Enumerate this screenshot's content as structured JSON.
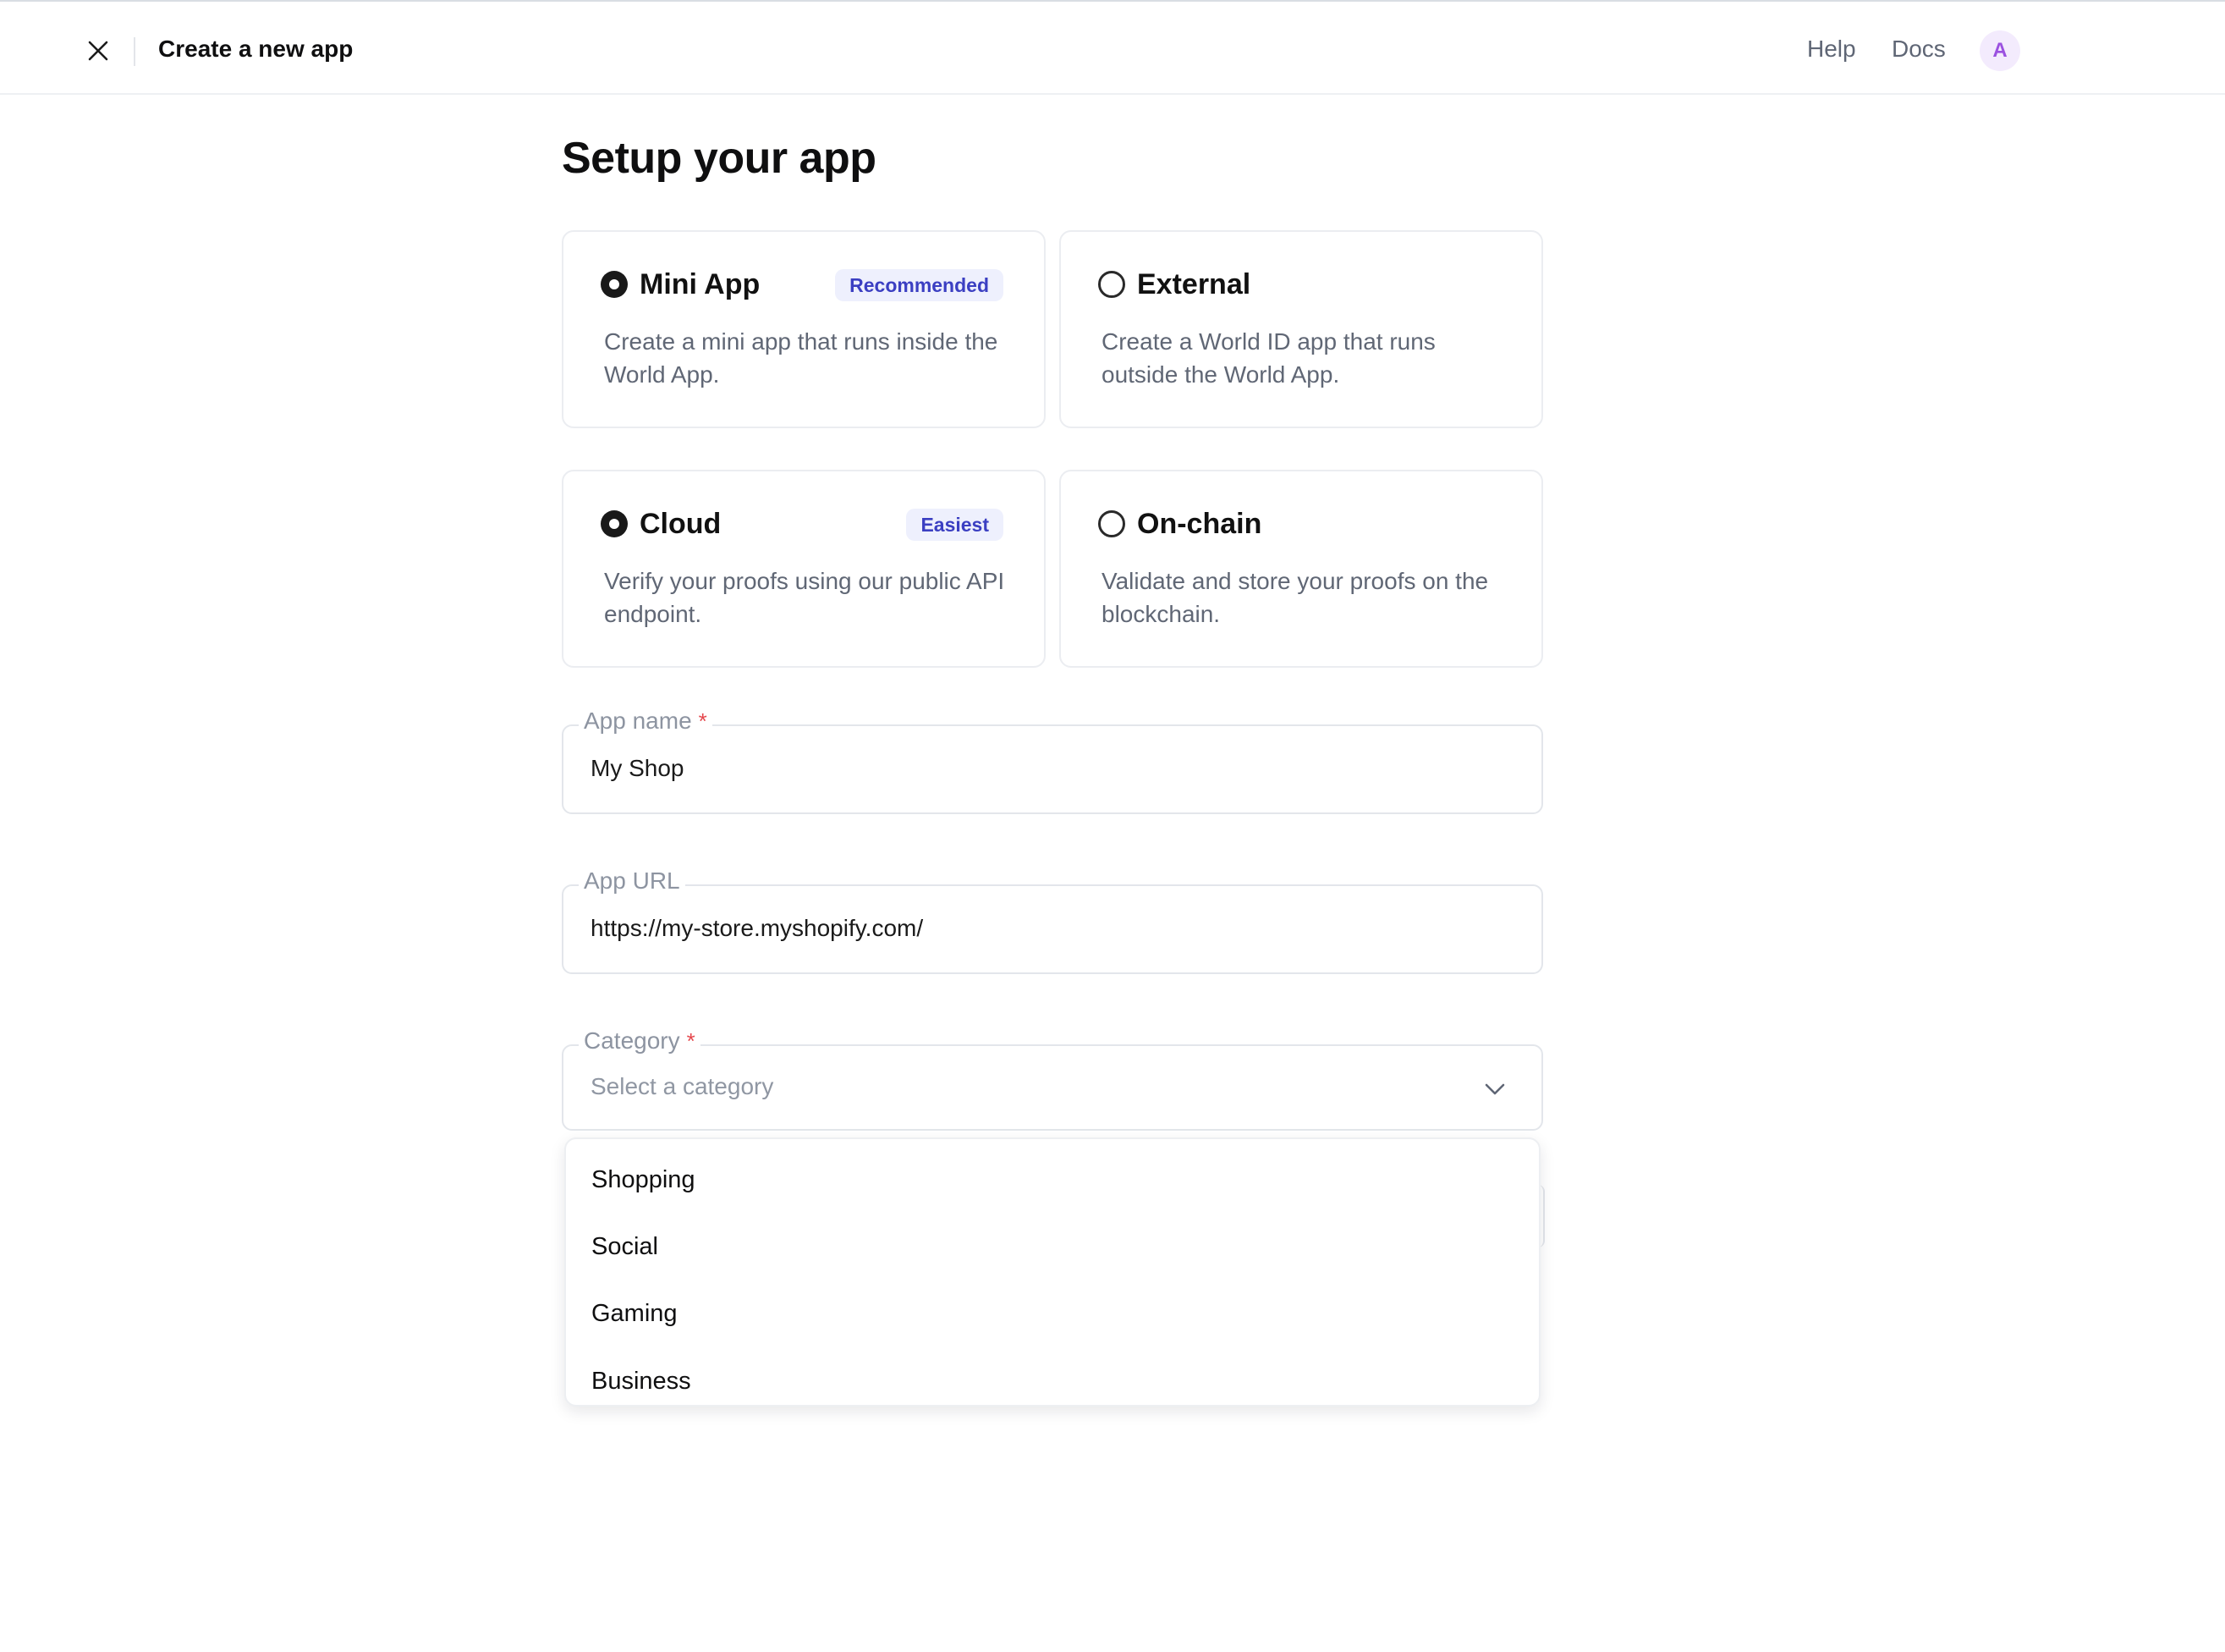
{
  "header": {
    "title": "Create a new app",
    "help": "Help",
    "docs": "Docs",
    "avatar_initial": "A"
  },
  "page": {
    "title": "Setup your app"
  },
  "app_types": [
    {
      "title": "Mini App",
      "badge": "Recommended",
      "description": "Create a mini app that runs inside the World App.",
      "selected": true
    },
    {
      "title": "External",
      "badge": "",
      "description": "Create a World ID app that runs outside the World App.",
      "selected": false
    }
  ],
  "verification_types": [
    {
      "title": "Cloud",
      "badge": "Easiest",
      "description": "Verify your proofs using our public API endpoint.",
      "selected": true
    },
    {
      "title": "On-chain",
      "badge": "",
      "description": "Validate and store your proofs on the blockchain.",
      "selected": false
    }
  ],
  "form": {
    "app_name": {
      "label": "App name",
      "required_mark": "*",
      "value": "My Shop"
    },
    "app_url": {
      "label": "App URL",
      "value": "https://my-store.myshopify.com/"
    },
    "category": {
      "label": "Category",
      "required_mark": "*",
      "placeholder": "Select a category"
    }
  },
  "category_options": [
    "Shopping",
    "Social",
    "Gaming",
    "Business"
  ],
  "colors": {
    "badge_bg": "#eef0fd",
    "badge_text": "#3b3fc2",
    "required": "#e5484d",
    "avatar_bg": "#f3ebfd",
    "avatar_text": "#9b51e0"
  }
}
